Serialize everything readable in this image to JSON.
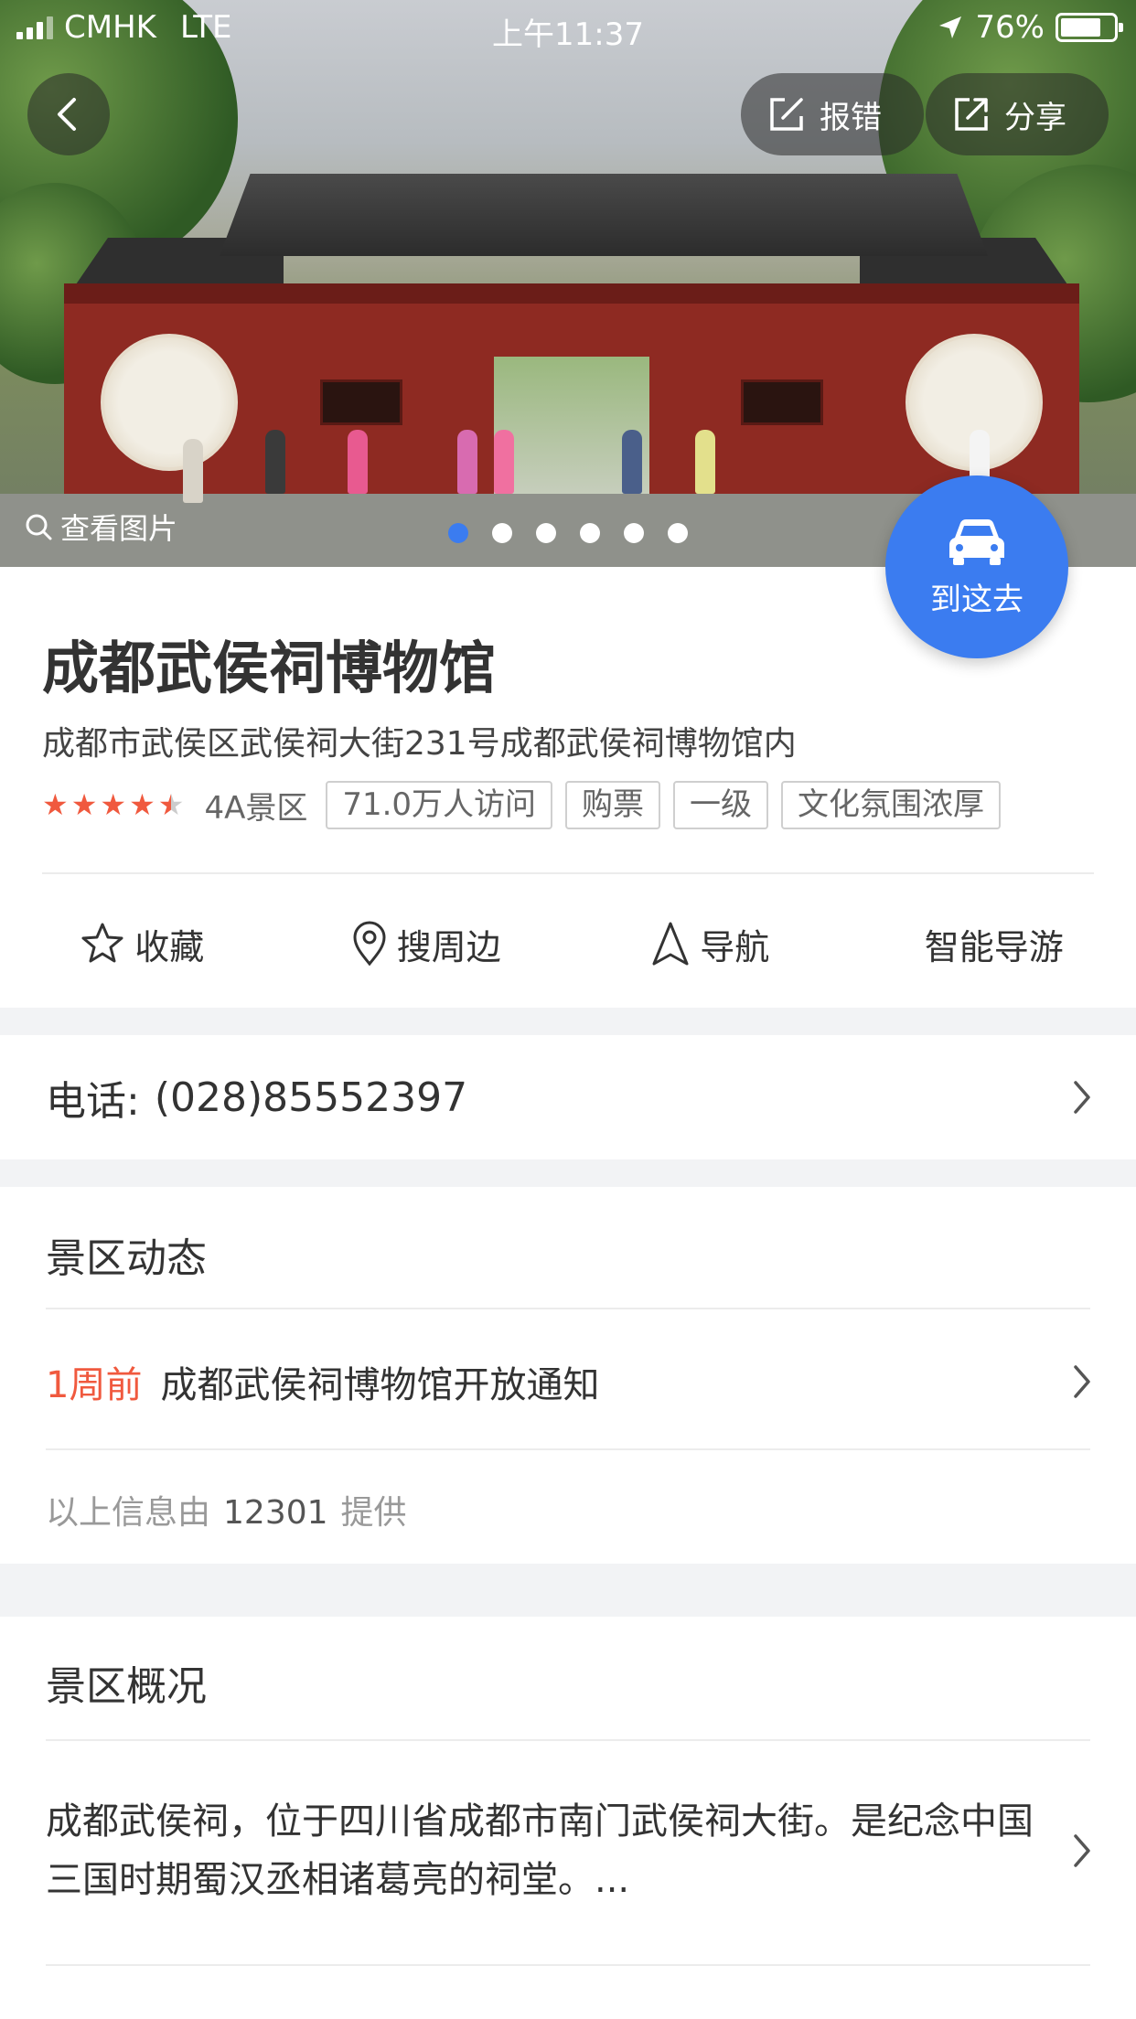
{
  "status_bar": {
    "carrier": "CMHK",
    "network": "LTE",
    "time": "上午11:37",
    "battery": "76%"
  },
  "hero": {
    "report_label": "报错",
    "share_label": "分享",
    "view_photos_label": "查看图片",
    "photo_count": 6,
    "active_photo": 1
  },
  "go_button": {
    "label": "到这去"
  },
  "place": {
    "name": "成都武侯祠博物馆",
    "address": "成都市武侯区武侯祠大街231号成都武侯祠博物馆内",
    "rating": 4.5,
    "level": "4A景区",
    "tags": [
      "71.0万人访问",
      "购票",
      "一级",
      "文化氛围浓厚"
    ]
  },
  "actions": [
    {
      "label": "收藏",
      "icon": "star-outline-icon"
    },
    {
      "label": "搜周边",
      "icon": "location-pin-icon"
    },
    {
      "label": "导航",
      "icon": "navigation-arrow-icon"
    },
    {
      "label": "智能导游",
      "icon": ""
    }
  ],
  "phone": {
    "label": "电话:",
    "number": "(028)85552397"
  },
  "news": {
    "title": "景区动态",
    "items": [
      {
        "when": "1周前",
        "text": "成都武侯祠博物馆开放通知"
      }
    ],
    "source_prefix": "以上信息由",
    "source_id": "12301",
    "source_suffix": "提供"
  },
  "overview": {
    "title": "景区概况",
    "text": "成都武侯祠，位于四川省成都市南门武侯祠大街。是纪念中国三国时期蜀汉丞相诸葛亮的祠堂。..."
  },
  "colors": {
    "accent": "#3b7cf0",
    "highlight": "#f0593e",
    "section_bg": "#f2f3f5"
  }
}
